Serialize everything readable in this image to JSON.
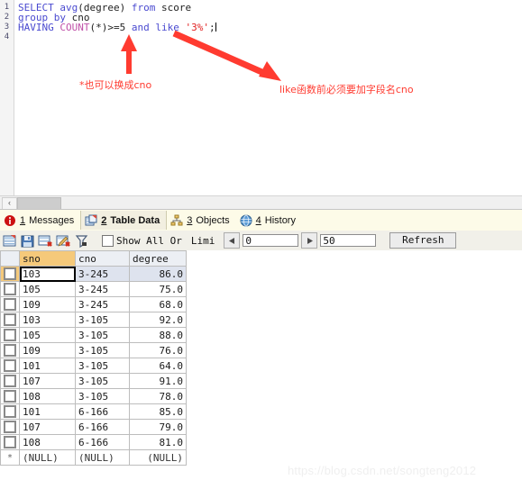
{
  "editor": {
    "line_numbers": [
      "1",
      "2",
      "3",
      "4"
    ],
    "sql_lines": [
      [
        {
          "t": "SELECT ",
          "c": "kw"
        },
        {
          "t": "avg",
          "c": "kw"
        },
        {
          "t": "(degree) ",
          "c": "pl"
        },
        {
          "t": "from ",
          "c": "kw"
        },
        {
          "t": "score",
          "c": "pl"
        }
      ],
      [
        {
          "t": "group by ",
          "c": "kw"
        },
        {
          "t": "cno",
          "c": "pl"
        }
      ],
      [
        {
          "t": "HAVING ",
          "c": "kw"
        },
        {
          "t": "COUNT",
          "c": "fn"
        },
        {
          "t": "(*)>=5 ",
          "c": "pl"
        },
        {
          "t": "and ",
          "c": "kw"
        },
        {
          "t": "like ",
          "c": "kw"
        },
        {
          "t": "'3%'",
          "c": "str"
        },
        {
          "t": ";",
          "c": "pl"
        }
      ],
      []
    ],
    "annotations": [
      {
        "id": "ann-left",
        "text": "*也可以换成cno"
      },
      {
        "id": "ann-right",
        "text": "like函数前必须要加字段名cno"
      }
    ],
    "annotation_color": "#ff3b30",
    "scrollbar_left_glyph": "‹"
  },
  "tabs": [
    {
      "num": "1",
      "label": "Messages",
      "icon": "info-circle-icon",
      "active": false
    },
    {
      "num": "2",
      "label": "Table Data",
      "icon": "table-data-icon",
      "active": true
    },
    {
      "num": "3",
      "label": "Objects",
      "icon": "objects-tree-icon",
      "active": false
    },
    {
      "num": "4",
      "label": "History",
      "icon": "globe-history-icon",
      "active": false
    }
  ],
  "data_toolbar": {
    "icons": [
      "form-view-icon",
      "save-record-icon",
      "delete-record-icon",
      "edit-record-icon",
      "filter-icon"
    ],
    "show_all_label": "Show All Or",
    "limit_label": "Limi",
    "offset_value": "0",
    "limit_value": "50",
    "prev_glyph": "◀",
    "next_glyph": "▶",
    "refresh_label": "Refresh",
    "show_all_checked": false
  },
  "grid": {
    "columns": [
      {
        "key": "sno",
        "label": "sno",
        "active": true
      },
      {
        "key": "cno",
        "label": "cno",
        "active": false
      },
      {
        "key": "degree",
        "label": "degree",
        "active": false
      }
    ],
    "rows": [
      {
        "sno": "103",
        "cno": "3-245",
        "degree": "86.0",
        "selected": true
      },
      {
        "sno": "105",
        "cno": "3-245",
        "degree": "75.0",
        "selected": false
      },
      {
        "sno": "109",
        "cno": "3-245",
        "degree": "68.0",
        "selected": false
      },
      {
        "sno": "103",
        "cno": "3-105",
        "degree": "92.0",
        "selected": false
      },
      {
        "sno": "105",
        "cno": "3-105",
        "degree": "88.0",
        "selected": false
      },
      {
        "sno": "109",
        "cno": "3-105",
        "degree": "76.0",
        "selected": false
      },
      {
        "sno": "101",
        "cno": "3-105",
        "degree": "64.0",
        "selected": false
      },
      {
        "sno": "107",
        "cno": "3-105",
        "degree": "91.0",
        "selected": false
      },
      {
        "sno": "108",
        "cno": "3-105",
        "degree": "78.0",
        "selected": false
      },
      {
        "sno": "101",
        "cno": "6-166",
        "degree": "85.0",
        "selected": false
      },
      {
        "sno": "107",
        "cno": "6-166",
        "degree": "79.0",
        "selected": false
      },
      {
        "sno": "108",
        "cno": "6-166",
        "degree": "81.0",
        "selected": false
      }
    ],
    "new_row": {
      "marker": "*",
      "sno": "(NULL)",
      "cno": "(NULL)",
      "degree": "(NULL)"
    }
  },
  "watermark": {
    "text": "https://blog.csdn.net/songteng2012"
  },
  "colors": {
    "keyword": "#4a4ad0",
    "function": "#c050a8",
    "string": "#e02020",
    "annotation": "#ff3b30",
    "active_header": "#f5c97a",
    "tab_bar_bg": "#fdfbe8"
  }
}
